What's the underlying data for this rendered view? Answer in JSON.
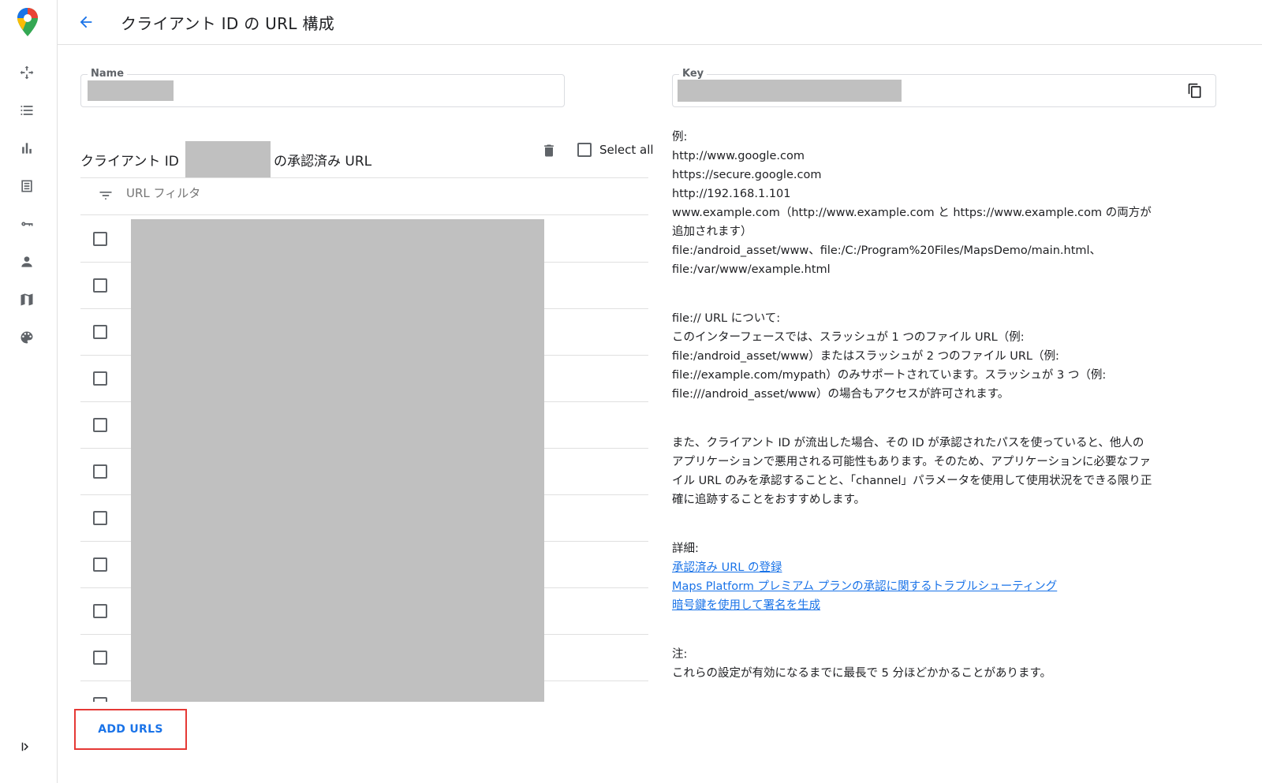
{
  "header": {
    "title": "クライアント ID の URL 構成"
  },
  "sidebar": {
    "items": [
      {
        "icon": "move-icon"
      },
      {
        "icon": "list-icon"
      },
      {
        "icon": "bar-chart-icon"
      },
      {
        "icon": "billing-icon"
      },
      {
        "icon": "key-icon"
      },
      {
        "icon": "person-icon"
      },
      {
        "icon": "map-icon"
      },
      {
        "icon": "palette-icon"
      }
    ]
  },
  "name_field": {
    "label": "Name",
    "value": ""
  },
  "key_field": {
    "label": "Key",
    "value": ""
  },
  "url_list": {
    "title_prefix": "クライアント ID",
    "title_suffix": "の承認済み URL",
    "select_all_label": "Select all",
    "filter_placeholder": "URL フィルタ",
    "row_count": 10,
    "add_button_label": "ADD URLS"
  },
  "help": {
    "examples_heading": "例:",
    "examples": [
      "http://www.google.com",
      "https://secure.google.com",
      "http://192.168.1.101",
      "www.example.com（http://www.example.com と https://www.example.com の両方が追加されます）",
      "file:/android_asset/www、file:/C:/Program%20Files/MapsDemo/main.html、file:/var/www/example.html"
    ],
    "file_heading": "file:// URL について:",
    "file_text": "このインターフェースでは、スラッシュが 1 つのファイル URL（例: file:/android_asset/www）またはスラッシュが 2 つのファイル URL（例: file://example.com/mypath）のみサポートされています。スラッシュが 3 つ（例: file:///android_asset/www）の場合もアクセスが許可されます。",
    "warning_text": "また、クライアント ID が流出した場合、その ID が承認されたパスを使っていると、他人のアプリケーションで悪用される可能性もあります。そのため、アプリケーションに必要なファイル URL のみを承認することと、「channel」パラメータを使用して使用状況をできる限り正確に追跡することをおすすめします。",
    "details_heading": "詳細:",
    "links": [
      "承認済み URL の登録",
      "Maps Platform プレミアム プランの承認に関するトラブルシューティング",
      "暗号鍵を使用して署名を生成"
    ],
    "note_heading": "注:",
    "note_text": "これらの設定が有効になるまでに最長で 5 分ほどかかることがあります。"
  },
  "colors": {
    "accent": "#1a73e8",
    "highlight_border": "#e53935",
    "redaction": "#c0c0c0"
  }
}
